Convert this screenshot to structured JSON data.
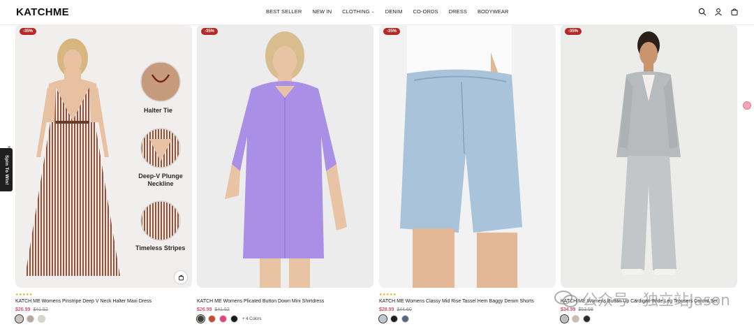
{
  "header": {
    "logo": "KATCHME",
    "nav": [
      {
        "label": "BEST SELLER"
      },
      {
        "label": "NEW IN"
      },
      {
        "label": "CLOTHING",
        "has_dropdown": true
      },
      {
        "label": "DENIM"
      },
      {
        "label": "CO-ORDS"
      },
      {
        "label": "DRESS"
      },
      {
        "label": "BODYWEAR"
      }
    ],
    "icons": [
      "search-icon",
      "account-icon",
      "cart-icon"
    ]
  },
  "products": [
    {
      "badge": "-35%",
      "rating": 5,
      "stars": "★★★★★",
      "title": "KATCH ME Womens Pinstripe Deep V Neck Halter Maxi Dress",
      "price": "$26.99",
      "compare_price": "$41.52",
      "callouts": [
        "Halter Tie",
        "Deep-V Plunge\nNeckline",
        "Timeless Stripes"
      ],
      "swatch_colors": [
        "#c9c2b6",
        "#b9a79b",
        "#d6d2cc"
      ],
      "more_colors": ""
    },
    {
      "badge": "-35%",
      "rating": 0,
      "stars": "",
      "title": "KATCH ME Womens Plicated Button Down Mini Shirtdress",
      "price": "$26.99",
      "compare_price": "$41.52",
      "swatch_colors": [
        "#3f3f38",
        "#c94a2f",
        "#e2457a",
        "#1b1b1b"
      ],
      "more_colors": "+ 4 Colors"
    },
    {
      "badge": "-35%",
      "rating": 5,
      "stars": "★★★★★",
      "title": "KATCH ME Womens Classy Mid Rise Tassel Hem Baggy Denim Shorts",
      "price": "$28.99",
      "compare_price": "$44.60",
      "swatch_colors": [
        "#b7c8d6",
        "#1d1d1d",
        "#55667e"
      ],
      "more_colors": ""
    },
    {
      "badge": "-35%",
      "rating": 0,
      "stars": "",
      "title": "KATCH ME Womens Button Up Cardigan Wide Leg Trousers Co-ord Set",
      "price": "$34.99",
      "compare_price": "$53.58",
      "swatch_colors": [
        "#b9bcbf",
        "#c9bda8",
        "#2a2a2a"
      ],
      "more_colors": ""
    }
  ],
  "spin_tab": {
    "label": "Spin To Win!",
    "close": "×"
  },
  "watermark": "公众号 · 独立站Jason",
  "colors": {
    "sale_badge": "#b52a26",
    "sale_price": "#c8102e",
    "stars": "#e0a800"
  }
}
